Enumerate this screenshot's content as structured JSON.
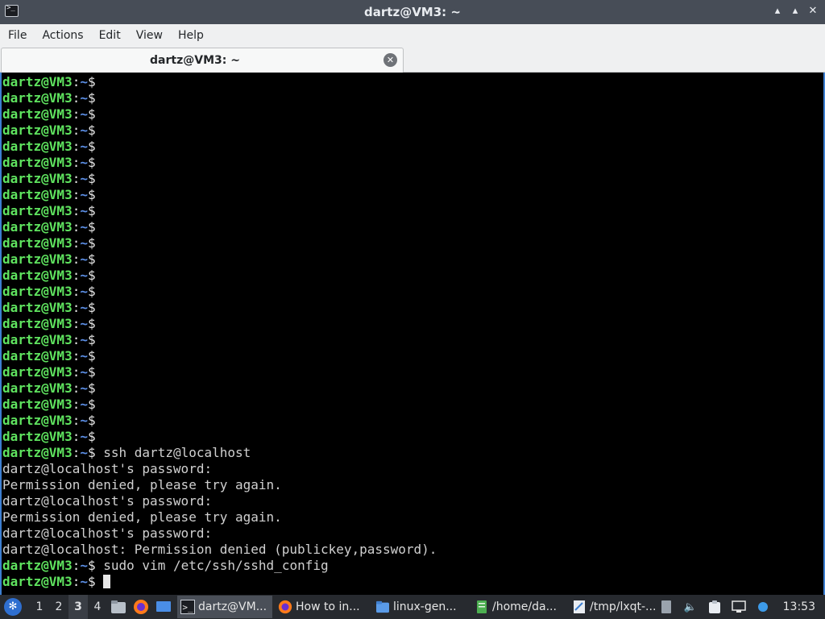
{
  "window": {
    "title": "dartz@VM3: ~"
  },
  "menu": [
    "File",
    "Actions",
    "Edit",
    "View",
    "Help"
  ],
  "tab": {
    "label": "dartz@VM3: ~"
  },
  "terminal": {
    "prompt": {
      "user_host": "dartz@VM3",
      "colon": ":",
      "path": "~",
      "symbol": "$"
    },
    "empty_prompt_count": 23,
    "lines": [
      {
        "type": "prompt",
        "text": " ssh dartz@localhost"
      },
      {
        "type": "output",
        "text": "dartz@localhost's password:"
      },
      {
        "type": "output",
        "text": "Permission denied, please try again."
      },
      {
        "type": "output",
        "text": "dartz@localhost's password:"
      },
      {
        "type": "output",
        "text": "Permission denied, please try again."
      },
      {
        "type": "output",
        "text": "dartz@localhost's password:"
      },
      {
        "type": "output",
        "text": "dartz@localhost: Permission denied (publickey,password)."
      },
      {
        "type": "prompt",
        "text": " sudo vim /etc/ssh/sshd_config"
      },
      {
        "type": "prompt",
        "text": " ",
        "cursor": true
      }
    ],
    "colors": {
      "user_host": "#5fe35f",
      "path": "#5c8fe6",
      "text": "#d0d0d0",
      "background": "#000000"
    }
  },
  "taskbar": {
    "workspaces": [
      "1",
      "2",
      "3",
      "4"
    ],
    "active_workspace": "3",
    "launchers": [
      "file-manager-icon",
      "firefox-icon",
      "desktop-icon"
    ],
    "tasks": [
      {
        "label": "dartz@VM...",
        "icon": "terminal-icon"
      },
      {
        "label": "How to in...",
        "icon": "firefox-icon"
      },
      {
        "label": "linux-gen...",
        "icon": "folder-icon"
      },
      {
        "label": "/home/da...",
        "icon": "text-editor-icon"
      },
      {
        "label": "/tmp/lxqt-...",
        "icon": "document-icon"
      }
    ],
    "tray_icons": [
      "notes-icon",
      "volume-icon",
      "clipboard-icon",
      "network-icon",
      "update-icon"
    ],
    "clock": "13:53"
  }
}
